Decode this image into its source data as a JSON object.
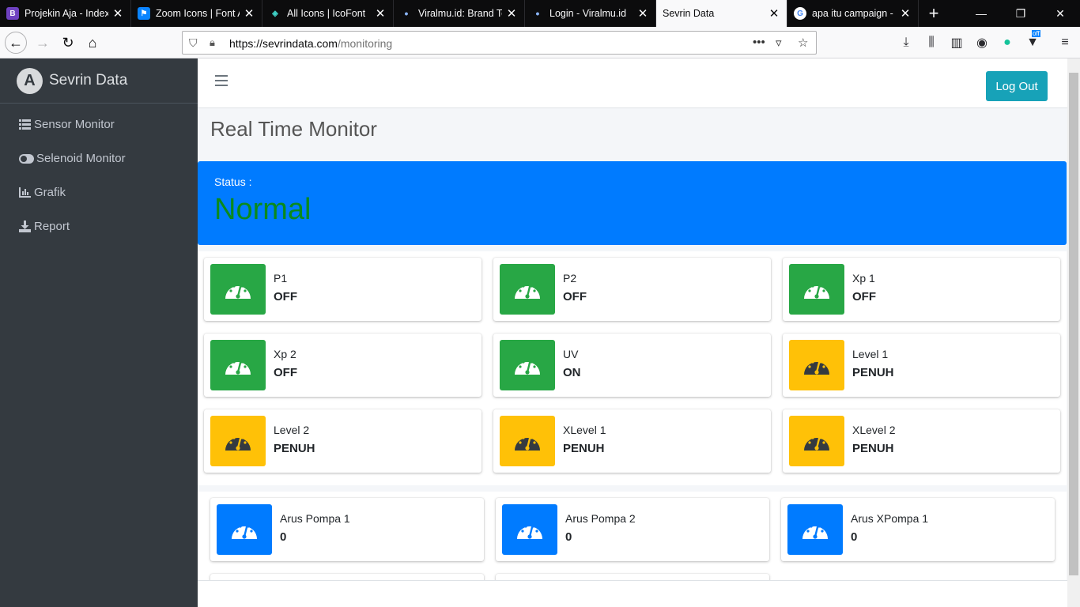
{
  "browser": {
    "tabs": [
      {
        "title": "Projekin Aja - Index",
        "icon": "bootstrap-icon"
      },
      {
        "title": "Zoom Icons | Font Awesome",
        "icon": "flag-icon"
      },
      {
        "title": "All Icons | IcoFont",
        "icon": "icofont-icon"
      },
      {
        "title": "Viralmu.id: Brand Tools",
        "icon": "dot-icon"
      },
      {
        "title": "Login - Viralmu.id",
        "icon": "dot-icon"
      },
      {
        "title": "Sevrin Data",
        "icon": "none",
        "active": true
      },
      {
        "title": "apa itu campaign - Google",
        "icon": "google-icon"
      }
    ],
    "url_domain": "https://sevrindata.com",
    "url_path": "/monitoring",
    "extension_badge": "off"
  },
  "sidebar": {
    "brand": "Sevrin Data",
    "brand_logo_letter": "A",
    "items": [
      {
        "label": "Sensor Monitor",
        "icon": "list-icon"
      },
      {
        "label": "Selenoid Monitor",
        "icon": "toggle-icon"
      },
      {
        "label": "Grafik",
        "icon": "bar-chart-icon"
      },
      {
        "label": "Report",
        "icon": "download-icon"
      }
    ]
  },
  "header": {
    "logout_label": "Log Out"
  },
  "page": {
    "title": "Real Time Monitor",
    "status_label": "Status :",
    "status_value": "Normal",
    "colors": {
      "green": "#28a745",
      "yellow": "#ffc107",
      "blue": "#007bff",
      "status_text": "#0a8a1c"
    }
  },
  "sensors": [
    {
      "name": "P1",
      "value": "OFF",
      "color": "green"
    },
    {
      "name": "P2",
      "value": "OFF",
      "color": "green"
    },
    {
      "name": "Xp 1",
      "value": "OFF",
      "color": "green"
    },
    {
      "name": "Xp 2",
      "value": "OFF",
      "color": "green"
    },
    {
      "name": "UV",
      "value": "ON",
      "color": "green"
    },
    {
      "name": "Level 1",
      "value": "PENUH",
      "color": "yellow"
    },
    {
      "name": "Level 2",
      "value": "PENUH",
      "color": "yellow"
    },
    {
      "name": "XLevel 1",
      "value": "PENUH",
      "color": "yellow"
    },
    {
      "name": "XLevel 2",
      "value": "PENUH",
      "color": "yellow"
    }
  ],
  "currents": [
    {
      "name": "Arus Pompa 1",
      "value": "0",
      "color": "blue"
    },
    {
      "name": "Arus Pompa 2",
      "value": "0",
      "color": "blue"
    },
    {
      "name": "Arus XPompa 1",
      "value": "0",
      "color": "blue"
    }
  ]
}
